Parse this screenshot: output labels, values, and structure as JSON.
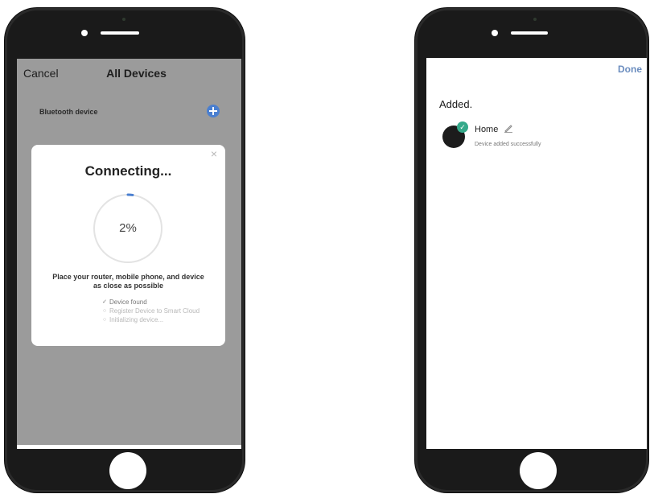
{
  "left_screen": {
    "nav": {
      "cancel_label": "Cancel",
      "title": "All Devices"
    },
    "section_label": "Bluetooth device",
    "add_icon": "plus-circle-icon",
    "dialog": {
      "close_glyph": "×",
      "title": "Connecting...",
      "progress_text": "2%",
      "progress_value": 0.02,
      "hint": "Place your router, mobile phone, and device as close as possible",
      "steps": [
        {
          "label": "Device found",
          "state": "done",
          "mark": "✓"
        },
        {
          "label": "Register Device to Smart Cloud",
          "state": "pending",
          "mark": "○"
        },
        {
          "label": "Initializing device...",
          "state": "pending",
          "mark": "○"
        }
      ]
    }
  },
  "right_screen": {
    "done_label": "Done",
    "heading": "Added.",
    "device": {
      "name": "Home",
      "status": "Device added successfully",
      "badge_glyph": "✓",
      "edit_icon": "pencil-icon"
    }
  },
  "colors": {
    "accent_blue": "#4a7fd0",
    "done_blue": "#6b8dbf",
    "success_green": "#35a98a",
    "overlay_gray": "#9b9b9b",
    "phone_body": "#1a1a1a"
  }
}
